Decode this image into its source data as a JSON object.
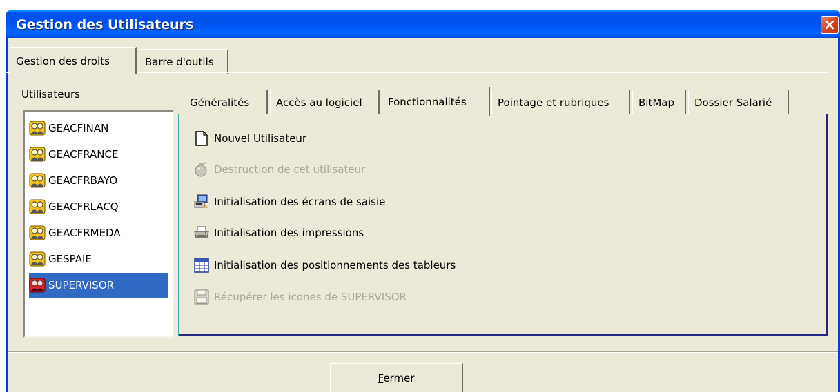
{
  "window": {
    "title": "Gestion des Utilisateurs"
  },
  "top_tabs": [
    {
      "label": "Gestion des droits",
      "active": true
    },
    {
      "label": "Barre d'outils",
      "active": false
    }
  ],
  "users": {
    "label_first": "U",
    "label_rest": "tilisateurs",
    "items": [
      {
        "name": "GEACFINAN",
        "icon": "group-icon",
        "selected": false
      },
      {
        "name": "GEACFRANCE",
        "icon": "group-icon",
        "selected": false
      },
      {
        "name": "GEACFRBAYO",
        "icon": "group-icon",
        "selected": false
      },
      {
        "name": "GEACFRLACQ",
        "icon": "group-icon",
        "selected": false
      },
      {
        "name": "GEACFRMEDA",
        "icon": "group-icon",
        "selected": false
      },
      {
        "name": "GESPAIE",
        "icon": "group-icon",
        "selected": false
      },
      {
        "name": "SUPERVISOR",
        "icon": "group-red-icon",
        "selected": true
      }
    ]
  },
  "inner_tabs": [
    {
      "label": "Généralités",
      "active": false
    },
    {
      "label": "Accès au logiciel",
      "active": false
    },
    {
      "label": "Fonctionnalités",
      "active": true
    },
    {
      "label": "Pointage et rubriques",
      "active": false
    },
    {
      "label": "BitMap",
      "active": false
    },
    {
      "label": "Dossier Salarié",
      "active": false
    }
  ],
  "functions": [
    {
      "label": "Nouvel Utilisateur",
      "icon": "new-document-icon",
      "enabled": true
    },
    {
      "label": "Destruction de cet utilisateur",
      "icon": "bomb-icon",
      "enabled": false
    },
    {
      "label": "Initialisation des écrans de saisie",
      "icon": "monitor-icon",
      "enabled": true
    },
    {
      "label": "Initialisation des impressions",
      "icon": "printer-icon",
      "enabled": true
    },
    {
      "label": "Initialisation des positionnements des tableurs",
      "icon": "spreadsheet-icon",
      "enabled": true
    },
    {
      "label": "Récupérer les icones de SUPERVISOR",
      "icon": "floppy-disk-icon",
      "enabled": false
    }
  ],
  "footer": {
    "close_first": "F",
    "close_rest": "ermer"
  }
}
